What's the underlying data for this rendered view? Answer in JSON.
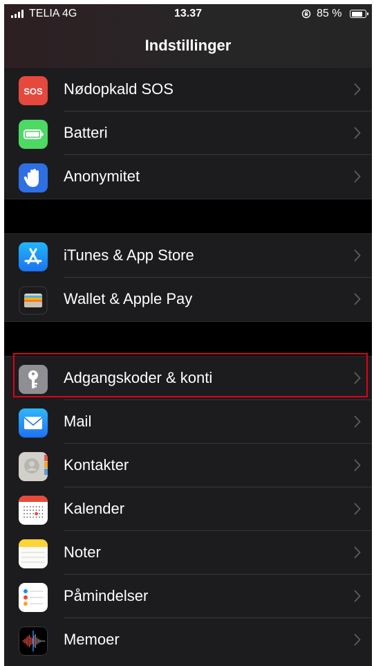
{
  "status_bar": {
    "carrier": "TELIA 4G",
    "time": "13.37",
    "battery_percent": "85 %",
    "battery_level": 0.85
  },
  "header": {
    "title": "Indstillinger"
  },
  "sections": [
    {
      "items": [
        {
          "id": "emergency-sos",
          "label": "Nødopkald SOS",
          "icon": "sos-icon",
          "icon_text": "SOS",
          "color": "#e5483d"
        },
        {
          "id": "battery",
          "label": "Batteri",
          "icon": "battery-icon",
          "color": "#4cd964"
        },
        {
          "id": "privacy",
          "label": "Anonymitet",
          "icon": "hand-icon",
          "color": "#2f6fe4"
        }
      ]
    },
    {
      "items": [
        {
          "id": "itunes-app-store",
          "label": "iTunes & App Store",
          "icon": "app-store-icon",
          "color": "#1e8ef5"
        },
        {
          "id": "wallet-apple-pay",
          "label": "Wallet & Apple Pay",
          "icon": "wallet-icon",
          "color": "#1c1c1e"
        }
      ]
    },
    {
      "items": [
        {
          "id": "passwords-accounts",
          "label": "Adgangskoder & konti",
          "icon": "key-icon",
          "color": "#8e8e93",
          "highlighted": true
        },
        {
          "id": "mail",
          "label": "Mail",
          "icon": "mail-icon",
          "color": "#2a8cf5"
        },
        {
          "id": "contacts",
          "label": "Kontakter",
          "icon": "contacts-icon",
          "color": "#d2d0cb"
        },
        {
          "id": "calendar",
          "label": "Kalender",
          "icon": "calendar-icon",
          "color": "#ffffff"
        },
        {
          "id": "notes",
          "label": "Noter",
          "icon": "notes-icon",
          "color": "#ffd436"
        },
        {
          "id": "reminders",
          "label": "Påmindelser",
          "icon": "reminders-icon",
          "color": "#ffffff"
        },
        {
          "id": "voice-memos",
          "label": "Memoer",
          "icon": "voice-memos-icon",
          "color": "#000000"
        }
      ]
    }
  ],
  "highlight_color": "#e2001a"
}
